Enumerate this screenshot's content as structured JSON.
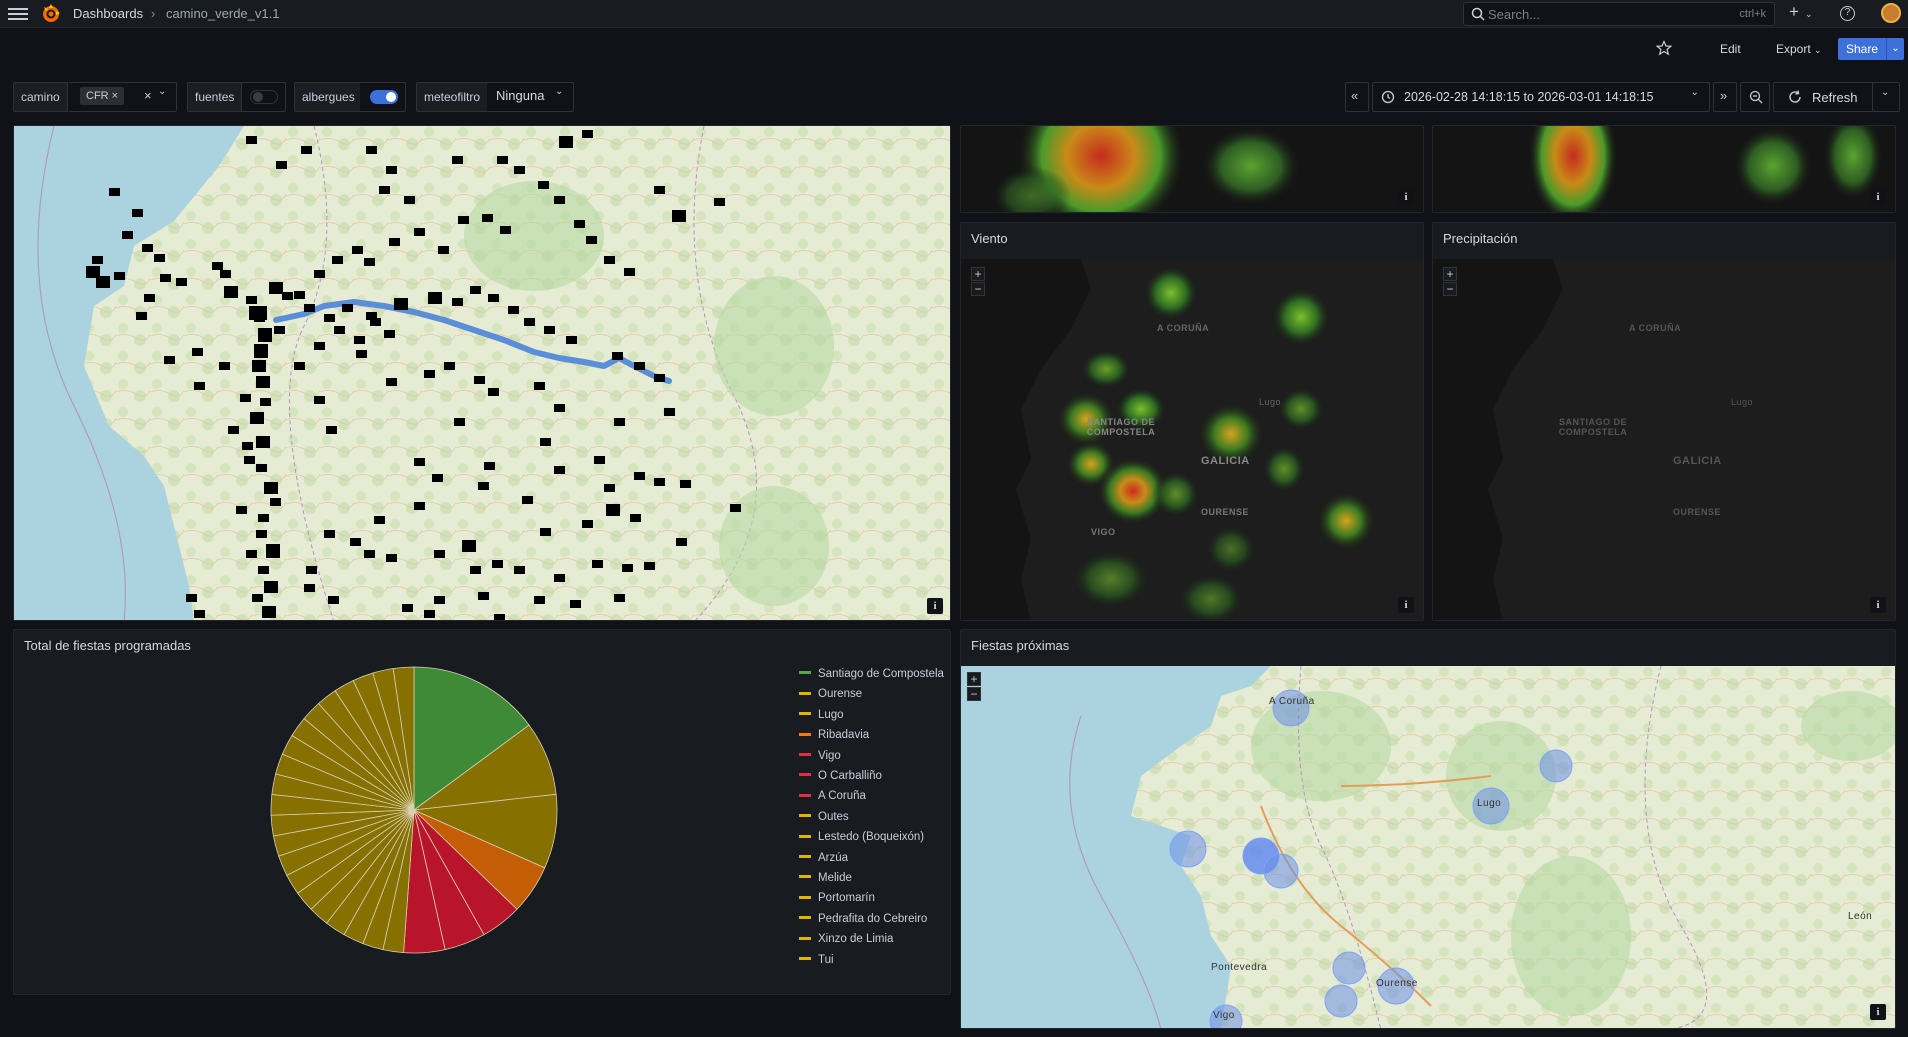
{
  "topbar": {
    "breadcrumb_home": "Dashboards",
    "breadcrumb_sep": "›",
    "breadcrumb_current": "camino_verde_v1.1",
    "search_placeholder": "Search...",
    "search_shortcut": "ctrl+k",
    "plus_label": "+",
    "help_label": "?"
  },
  "toolbar": {
    "edit_label": "Edit",
    "export_label": "Export",
    "share_label": "Share"
  },
  "variables": {
    "camino": {
      "label": "camino",
      "chip": "CFR"
    },
    "fuentes": {
      "label": "fuentes",
      "enabled": false
    },
    "albergues": {
      "label": "albergues",
      "enabled": true
    },
    "meteofiltro": {
      "label": "meteofiltro",
      "value": "Ninguna"
    }
  },
  "timepicker": {
    "range": "2026-02-28 14:18:15 to 2026-03-01 14:18:15",
    "refresh_label": "Refresh"
  },
  "panels": {
    "viento": {
      "title": "Viento"
    },
    "precipitacion": {
      "title": "Precipitación"
    },
    "fiestas_total": {
      "title": "Total de fiestas programadas"
    },
    "fiestas_proximas": {
      "title": "Fiestas próximas"
    }
  },
  "map_labels": {
    "a_coruna": "A CORUÑA",
    "lugo": "Lugo",
    "santiago": "SANTIAGO DE COMPOSTELA",
    "galicia": "GALICIA",
    "ourense": "OURENSE",
    "vigo": "VIGO",
    "pontevedra": "Pontevedra",
    "leon": "León",
    "ourense_city": "Ourense",
    "lugo_city": "Lugo",
    "a_coruna_city": "A Coruña",
    "vigo_city": "Vigo"
  },
  "colors": {
    "accent": "#3d71d9",
    "panel_bg": "#181b1f",
    "page_bg": "#111217"
  },
  "chart_data": {
    "type": "pie",
    "title": "Total de fiestas programadas",
    "legend": [
      {
        "name": "Santiago de Compostela",
        "color": "#56a64b"
      },
      {
        "name": "Ourense",
        "color": "#e0b400"
      },
      {
        "name": "Lugo",
        "color": "#e0b400"
      },
      {
        "name": "Ribadavia",
        "color": "#ff780a"
      },
      {
        "name": "Vigo",
        "color": "#e02f44"
      },
      {
        "name": "O Carballiño",
        "color": "#e02f44"
      },
      {
        "name": "A Coruña",
        "color": "#e02f44"
      },
      {
        "name": "Outes",
        "color": "#e0b400"
      },
      {
        "name": "Lestedo (Boqueixón)",
        "color": "#e0b400"
      },
      {
        "name": "Arzúa",
        "color": "#e0b400"
      },
      {
        "name": "Melide",
        "color": "#e0b400"
      },
      {
        "name": "Portomarín",
        "color": "#e0b400"
      },
      {
        "name": "Pedrafita do Cebreiro",
        "color": "#e0b400"
      },
      {
        "name": "Xinzo de Limia",
        "color": "#e0b400"
      },
      {
        "name": "Tui",
        "color": "#e0b400"
      }
    ],
    "slices": [
      {
        "value": 16,
        "color": "#3e8a36"
      },
      {
        "value": 9,
        "color": "#857000"
      },
      {
        "value": 9,
        "color": "#857000"
      },
      {
        "value": 6,
        "color": "#c45e06"
      },
      {
        "value": 5,
        "color": "#b8142a"
      },
      {
        "value": 5,
        "color": "#b8142a"
      },
      {
        "value": 5,
        "color": "#b8142a"
      },
      {
        "value": 2.5,
        "color": "#857000"
      },
      {
        "value": 2.5,
        "color": "#857000"
      },
      {
        "value": 2.5,
        "color": "#857000"
      },
      {
        "value": 2.5,
        "color": "#857000"
      },
      {
        "value": 2.5,
        "color": "#857000"
      },
      {
        "value": 2.5,
        "color": "#857000"
      },
      {
        "value": 2.5,
        "color": "#857000"
      },
      {
        "value": 2.5,
        "color": "#857000"
      },
      {
        "value": 2.5,
        "color": "#857000"
      },
      {
        "value": 2.5,
        "color": "#857000"
      },
      {
        "value": 2.5,
        "color": "#857000"
      },
      {
        "value": 2.5,
        "color": "#857000"
      },
      {
        "value": 2.5,
        "color": "#857000"
      },
      {
        "value": 2.5,
        "color": "#857000"
      },
      {
        "value": 2.5,
        "color": "#857000"
      },
      {
        "value": 2.5,
        "color": "#857000"
      },
      {
        "value": 2.5,
        "color": "#857000"
      },
      {
        "value": 2.5,
        "color": "#857000"
      },
      {
        "value": 2.5,
        "color": "#857000"
      },
      {
        "value": 2.5,
        "color": "#857000"
      },
      {
        "value": 2.5,
        "color": "#857000"
      }
    ]
  }
}
